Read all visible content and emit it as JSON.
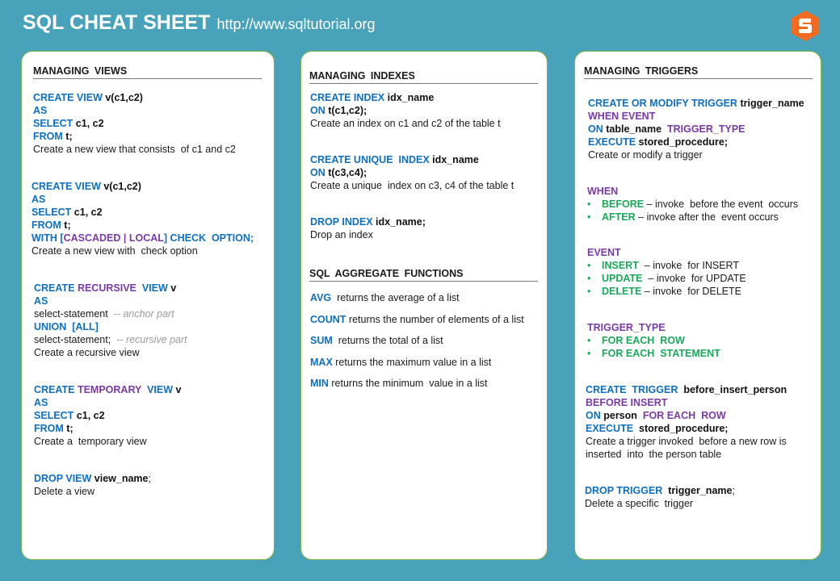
{
  "header": {
    "title": "SQL CHEAT SHEET",
    "url": "http://www.sqltutorial.org",
    "logo_icon": "sqltutorial-hexagon-s-logo",
    "logo_color": "#f26b21"
  },
  "colors": {
    "background": "#48a3ba",
    "keyword_blue": "#0f6fbf",
    "keyword_purple": "#7a3aa5",
    "keyword_green": "#1aa85a",
    "card_border": "#7cb342"
  },
  "views": {
    "title": "MANAGING  VIEWS",
    "blocks": [
      [
        [
          [
            "kw",
            "CREATE VIEW "
          ],
          [
            "id",
            "v(c1,c2)"
          ]
        ],
        [
          [
            "kw",
            "AS"
          ]
        ],
        [
          [
            "kw",
            "SELECT "
          ],
          [
            "id",
            "c1, c2"
          ]
        ],
        [
          [
            "kw",
            "FROM "
          ],
          [
            "id",
            "t;"
          ]
        ],
        [
          [
            "tx",
            "Create a new view that consists  of c1 and c2"
          ]
        ]
      ],
      [
        [
          [
            "kw",
            "CREATE VIEW "
          ],
          [
            "id",
            "v(c1,c2)"
          ]
        ],
        [
          [
            "kw",
            "AS"
          ]
        ],
        [
          [
            "kw",
            "SELECT "
          ],
          [
            "id",
            "c1, c2"
          ]
        ],
        [
          [
            "kw",
            "FROM "
          ],
          [
            "id",
            "t;"
          ]
        ],
        [
          [
            "kw",
            "WITH ["
          ],
          [
            "pu",
            "CASCADED | LOCAL"
          ],
          [
            "kw",
            "] CHECK  OPTION;"
          ]
        ],
        [
          [
            "tx",
            "Create a new view with  check option"
          ]
        ]
      ],
      [
        [
          [
            "kw",
            "CREATE "
          ],
          [
            "pu",
            "RECURSIVE "
          ],
          [
            "kw",
            " VIEW "
          ],
          [
            "id",
            "v"
          ]
        ],
        [
          [
            "kw",
            "AS"
          ]
        ],
        [
          [
            "tx",
            "select-statement  "
          ],
          [
            "cm",
            "-- anchor part"
          ]
        ],
        [
          [
            "kw",
            "UNION  [ALL]"
          ]
        ],
        [
          [
            "tx",
            "select-statement;  "
          ],
          [
            "cm",
            "-- recursive part"
          ]
        ],
        [
          [
            "tx",
            "Create a recursive view"
          ]
        ]
      ],
      [
        [
          [
            "kw",
            "CREATE "
          ],
          [
            "pu",
            "TEMPORARY "
          ],
          [
            "kw",
            " VIEW "
          ],
          [
            "id",
            "v"
          ]
        ],
        [
          [
            "kw",
            "AS"
          ]
        ],
        [
          [
            "kw",
            "SELECT "
          ],
          [
            "id",
            "c1, c2"
          ]
        ],
        [
          [
            "kw",
            "FROM "
          ],
          [
            "id",
            "t;"
          ]
        ],
        [
          [
            "tx",
            "Create a  temporary view"
          ]
        ]
      ],
      [
        [
          [
            "kw",
            "DROP VIEW "
          ],
          [
            "id",
            "view_name"
          ],
          [
            "tx",
            ";"
          ]
        ],
        [
          [
            "tx",
            "Delete a view"
          ]
        ]
      ]
    ]
  },
  "indexes": {
    "title": "MANAGING  INDEXES",
    "blocks": [
      [
        [
          [
            "kw",
            "CREATE INDEX "
          ],
          [
            "id",
            "idx_name"
          ]
        ],
        [
          [
            "kw",
            "ON "
          ],
          [
            "id",
            "t(c1,c2);"
          ]
        ],
        [
          [
            "tx",
            "Create an index on c1 and c2 of the table t"
          ]
        ]
      ],
      [
        [
          [
            "kw",
            "CREATE UNIQUE  INDEX "
          ],
          [
            "id",
            "idx_name"
          ]
        ],
        [
          [
            "kw",
            "ON "
          ],
          [
            "id",
            "t(c3,c4);"
          ]
        ],
        [
          [
            "tx",
            "Create a unique  index on c3, c4 of the table t"
          ]
        ]
      ],
      [
        [
          [
            "kw",
            "DROP INDEX "
          ],
          [
            "id",
            "idx_name;"
          ]
        ],
        [
          [
            "tx",
            "Drop an index"
          ]
        ]
      ]
    ]
  },
  "aggregates": {
    "title": "SQL AGGREGATE  FUNCTIONS",
    "items": [
      {
        "fn": "AVG",
        "desc": "  returns the average of a list"
      },
      {
        "fn": "COUNT",
        "desc": " returns the number of elements of a list"
      },
      {
        "fn": "SUM",
        "desc": "  returns the total of a list"
      },
      {
        "fn": "MAX",
        "desc": " returns the maximum value in a list"
      },
      {
        "fn": "MIN",
        "desc": " returns the minimum  value in a list"
      }
    ]
  },
  "triggers": {
    "title": "MANAGING  TRIGGERS",
    "blocks": [
      [
        [
          [
            "kw",
            "CREATE OR MODIFY TRIGGER "
          ],
          [
            "id",
            "trigger_name"
          ]
        ],
        [
          [
            "pu",
            "WHEN EVENT"
          ]
        ],
        [
          [
            "kw",
            "ON "
          ],
          [
            "id",
            "table_name  "
          ],
          [
            "pu",
            "TRIGGER_TYPE"
          ]
        ],
        [
          [
            "kw",
            "EXECUTE "
          ],
          [
            "id",
            "stored_procedure;"
          ]
        ],
        [
          [
            "tx",
            "Create or modify a trigger"
          ]
        ]
      ],
      [
        [
          [
            "pu",
            "WHEN"
          ]
        ],
        [
          [
            "bl",
            "•"
          ],
          [
            "gr",
            "BEFORE"
          ],
          [
            "tx",
            " – invoke  before the event  occurs"
          ]
        ],
        [
          [
            "bl",
            "•"
          ],
          [
            "gr",
            "AFTER"
          ],
          [
            "tx",
            " – invoke after the  event occurs"
          ]
        ]
      ],
      [
        [
          [
            "pu",
            "EVENT"
          ]
        ],
        [
          [
            "bl",
            "•"
          ],
          [
            "gr",
            "INSERT"
          ],
          [
            "tx",
            "  – invoke  for INSERT"
          ]
        ],
        [
          [
            "bl",
            "•"
          ],
          [
            "gr",
            "UPDATE"
          ],
          [
            "tx",
            "  – invoke  for UPDATE"
          ]
        ],
        [
          [
            "bl",
            "•"
          ],
          [
            "gr",
            "DELETE"
          ],
          [
            "tx",
            " – invoke  for DELETE"
          ]
        ]
      ],
      [
        [
          [
            "pu",
            "TRIGGER_TYPE"
          ]
        ],
        [
          [
            "bl",
            "•"
          ],
          [
            "gr",
            "FOR EACH  ROW"
          ]
        ],
        [
          [
            "bl",
            "•"
          ],
          [
            "gr",
            "FOR EACH  STATEMENT"
          ]
        ]
      ],
      [
        [
          [
            "kw",
            "CREATE  TRIGGER  "
          ],
          [
            "id",
            "before_insert_person"
          ]
        ],
        [
          [
            "pu",
            "BEFORE INSERT"
          ]
        ],
        [
          [
            "kw",
            "ON "
          ],
          [
            "id",
            "person  "
          ],
          [
            "pu",
            "FOR EACH  ROW"
          ]
        ],
        [
          [
            "kw",
            "EXECUTE  "
          ],
          [
            "id",
            "stored_procedure;"
          ]
        ],
        [
          [
            "tx",
            "Create a trigger invoked  before a new row is"
          ]
        ],
        [
          [
            "tx",
            "inserted  into  the person table"
          ]
        ]
      ],
      [
        [
          [
            "kw",
            "DROP TRIGGER  "
          ],
          [
            "id",
            "trigger_name"
          ],
          [
            "tx",
            ";"
          ]
        ],
        [
          [
            "tx",
            "Delete a specific  trigger"
          ]
        ]
      ]
    ]
  }
}
